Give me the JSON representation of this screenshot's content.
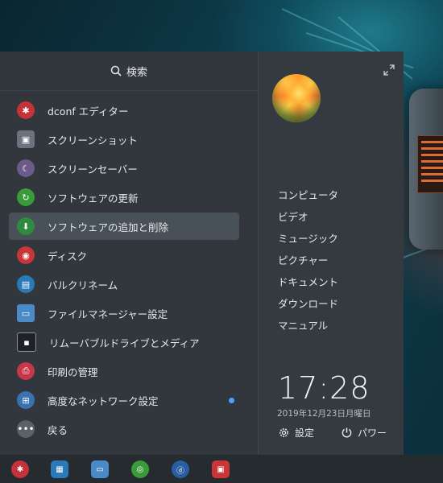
{
  "search": {
    "label": "検索"
  },
  "apps": [
    {
      "label": "dconf エディター",
      "icon": "dconf-editor-icon",
      "color": "#c4323a"
    },
    {
      "label": "スクリーンショット",
      "icon": "screenshot-icon",
      "color": "#6a7380"
    },
    {
      "label": "スクリーンセーバー",
      "icon": "screensaver-icon",
      "color": "#6b5a8a"
    },
    {
      "label": "ソフトウェアの更新",
      "icon": "software-update-icon",
      "color": "#3a9b3a"
    },
    {
      "label": "ソフトウェアの追加と削除",
      "icon": "software-install-icon",
      "color": "#2e8a3e"
    },
    {
      "label": "ディスク",
      "icon": "disks-icon",
      "color": "#c8363a"
    },
    {
      "label": "バルクリネーム",
      "icon": "bulk-rename-icon",
      "color": "#2a7ab8"
    },
    {
      "label": "ファイルマネージャー設定",
      "icon": "file-manager-settings-icon",
      "color": "#4a8ac8"
    },
    {
      "label": "リムーバブルドライブとメディア",
      "icon": "removable-drive-icon",
      "color": "#3a4046"
    },
    {
      "label": "印刷の管理",
      "icon": "printer-icon",
      "color": "#c8364a"
    },
    {
      "label": "高度なネットワーク設定",
      "icon": "network-settings-icon",
      "color": "#3a74b0"
    }
  ],
  "back": {
    "label": "戻る"
  },
  "places": [
    "コンピュータ",
    "ビデオ",
    "ミュージック",
    "ピクチャー",
    "ドキュメント",
    "ダウンロード",
    "マニュアル"
  ],
  "clock": {
    "time": "17:28",
    "date": "2019年12月23日月曜日"
  },
  "buttons": {
    "settings": "設定",
    "power": "パワー"
  },
  "panel_icons": [
    "dconf-editor-icon",
    "screenshot-icon",
    "file-manager-icon",
    "software-update-icon",
    "software-install-icon",
    "disks-icon"
  ],
  "colors": {
    "menu_bg": "#31373d",
    "selected_bg": "#485058",
    "accent_dot": "#4aa3ff",
    "panel_bg": "#262b30"
  }
}
